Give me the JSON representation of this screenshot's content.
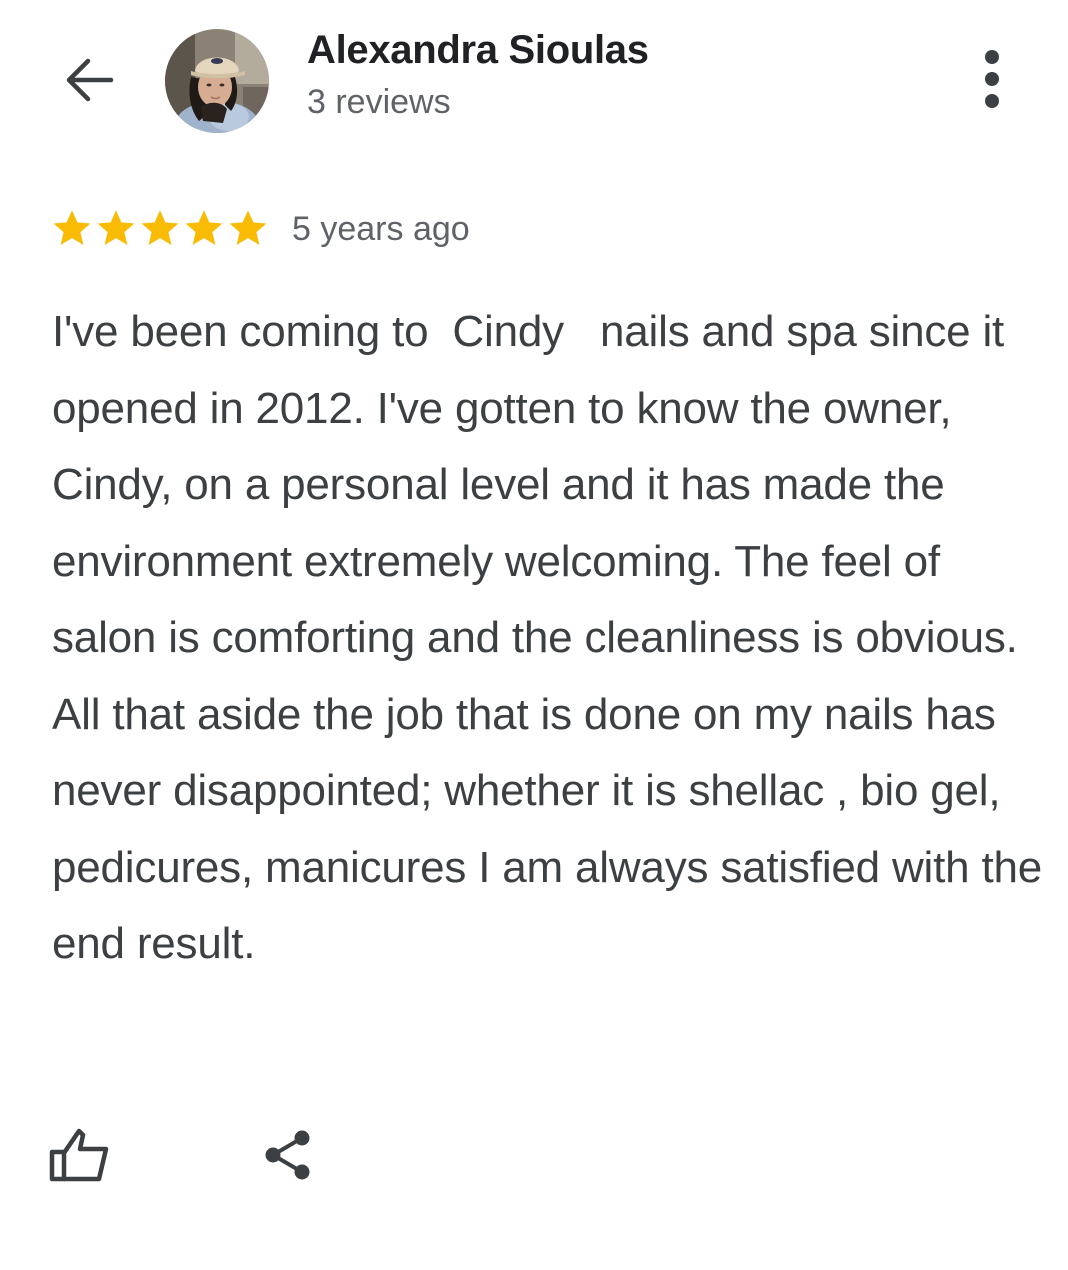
{
  "header": {
    "back_icon": "arrow-back-icon",
    "user_name": "Alexandra Sioulas",
    "review_count": "3 reviews",
    "more_icon": "more-vertical-icon"
  },
  "review": {
    "rating": 5,
    "rating_max": 5,
    "date": "5 years ago",
    "text": "I've been coming to  Cindy   nails and spa since it opened in 2012. I've gotten to know the owner, Cindy, on a personal level and it has made the environment extremely welcoming. The feel of salon is comforting and the cleanliness is obvious. All that aside the job that is done on my nails has never disappointed; whether it is shellac , bio gel, pedicures, manicures I am always satisfied with the end result."
  },
  "actions": {
    "like_icon": "thumbs-up-icon",
    "share_icon": "share-icon"
  },
  "colors": {
    "star": "#f9bb04",
    "name": "#202124",
    "secondary_text": "#5f6368",
    "body_text": "#3c4043",
    "icon": "#3c4043"
  }
}
